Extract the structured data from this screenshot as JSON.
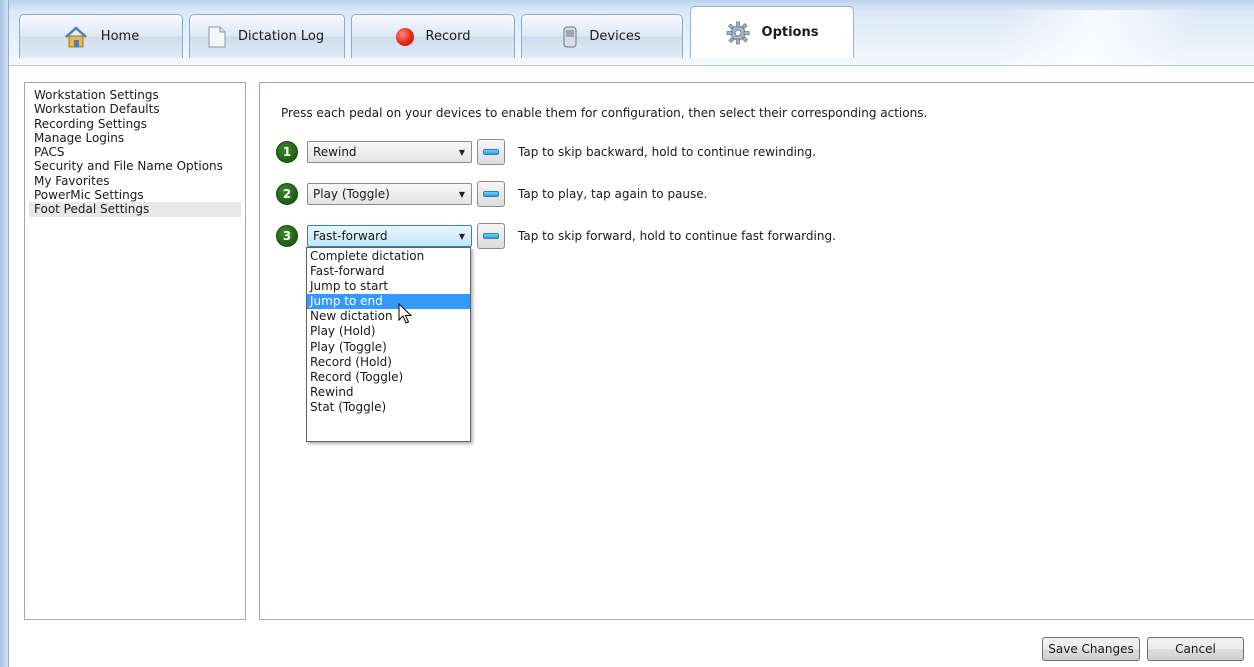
{
  "tabs": [
    {
      "label": "Home",
      "icon": "home-icon"
    },
    {
      "label": "Dictation Log",
      "icon": "document-icon"
    },
    {
      "label": "Record",
      "icon": "record-icon"
    },
    {
      "label": "Devices",
      "icon": "device-icon"
    },
    {
      "label": "Options",
      "icon": "gear-icon",
      "active": true
    }
  ],
  "sidebar": {
    "items": [
      {
        "label": "Workstation Settings"
      },
      {
        "label": "Workstation Defaults"
      },
      {
        "label": "Recording Settings"
      },
      {
        "label": "Manage Logins"
      },
      {
        "label": "PACS"
      },
      {
        "label": "Security and File Name Options"
      },
      {
        "label": "My Favorites"
      },
      {
        "label": "PowerMic Settings"
      },
      {
        "label": "Foot Pedal Settings",
        "selected": true
      }
    ]
  },
  "main": {
    "instructions": "Press each pedal on your devices to enable them for configuration, then select their corresponding actions.",
    "pedals": [
      {
        "number": "1",
        "action": "Rewind",
        "description": "Tap to skip backward, hold to continue rewinding."
      },
      {
        "number": "2",
        "action": "Play (Toggle)",
        "description": "Tap to play, tap again to pause."
      },
      {
        "number": "3",
        "action": "Fast-forward",
        "description": "Tap to skip forward, hold to continue fast forwarding."
      }
    ],
    "dropdown_options": [
      "Complete dictation",
      "Fast-forward",
      "Jump to start",
      "Jump to end",
      "New dictation",
      "Play (Hold)",
      "Play (Toggle)",
      "Record (Hold)",
      "Record (Toggle)",
      "Rewind",
      "Stat (Toggle)"
    ],
    "highlighted_option": "Jump to end"
  },
  "footer": {
    "save_label": "Save Changes",
    "cancel_label": "Cancel"
  },
  "colors": {
    "pedal_badge": "#1f5e14",
    "highlight": "#3399ff",
    "minus_button": "#2a9ee0",
    "record_dot": "#e3261b"
  }
}
